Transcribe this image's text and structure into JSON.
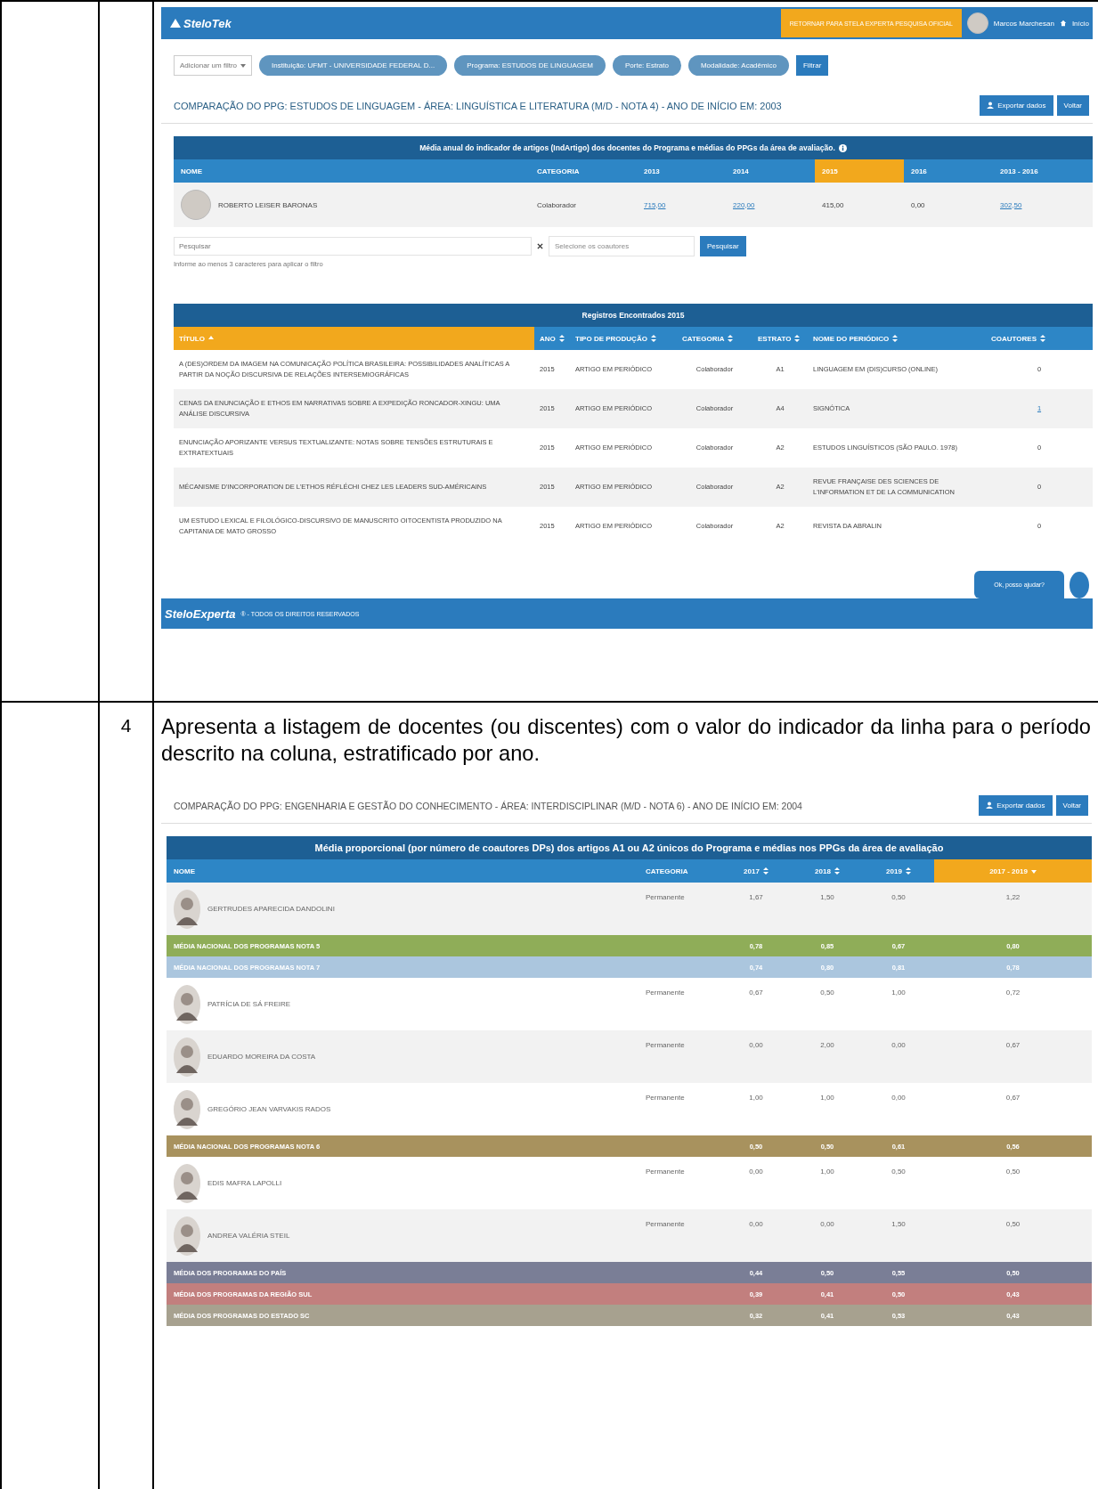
{
  "doc_rows": [
    {
      "number": "",
      "description": "",
      "screenshot": {
        "kind": "app"
      }
    },
    {
      "number": "4",
      "description": "Apresenta a listagem de docentes (ou discentes) com o valor do indicador da linha para o período descrito na coluna, estratificado por ano.",
      "screenshot": {
        "kind": "table"
      }
    }
  ],
  "app": {
    "logo": "SteloTek",
    "return_button": "RETORNAR PARA STELA EXPERTA PESQUISA OFICIAL",
    "user": "Marcos Marchesan",
    "nav_links": [
      "Início"
    ],
    "filter_dropdown": "Adicionar um filtro",
    "filter_chips": [
      "Instituição: UFMT - UNIVERSIDADE FEDERAL D...",
      "Programa: ESTUDOS DE LINGUAGEM",
      "Porte: Estrato",
      "Modalidade: Acadêmico"
    ],
    "filter_button": "Filtrar",
    "title": "COMPARAÇÃO DO PPG: ESTUDOS DE LINGUAGEM - ÁREA: LINGUÍSTICA E LITERATURA (M/D - NOTA 4) - ANO DE INÍCIO EM: 2003",
    "export_button": "Exportar dados",
    "back_button": "Voltar",
    "indicator_table": {
      "caption": "Média anual do indicador de artigos (IndArtigo) dos docentes do Programa e médias do PPGs da área de avaliação.",
      "columns": [
        {
          "label": "NOME",
          "selected": false
        },
        {
          "label": "CATEGORIA",
          "selected": false
        },
        {
          "label": "2013",
          "selected": false
        },
        {
          "label": "2014",
          "selected": false
        },
        {
          "label": "2015",
          "selected": true
        },
        {
          "label": "2016",
          "selected": false
        },
        {
          "label": "2013 - 2016",
          "selected": false
        }
      ],
      "rows": [
        {
          "name": "ROBERTO LEISER BARONAS",
          "category": "Colaborador",
          "values": [
            {
              "text": "715,00",
              "link": true
            },
            {
              "text": "220,00",
              "link": true
            },
            {
              "text": "415,00",
              "link": false
            },
            {
              "text": "0,00",
              "link": false
            },
            {
              "text": "302,50",
              "link": true
            }
          ]
        }
      ]
    },
    "search": {
      "placeholder": "Pesquisar",
      "hint": "Informe ao menos 3 caracteres para aplicar o filtro",
      "coauthor_select": "Selecione os coautores",
      "button": "Pesquisar"
    },
    "records_table": {
      "caption": "Registros Encontrados 2015",
      "columns": [
        {
          "label": "TÍTULO",
          "selected": true
        },
        {
          "label": "ANO",
          "selected": false
        },
        {
          "label": "TIPO DE PRODUÇÃO",
          "selected": false
        },
        {
          "label": "CATEGORIA",
          "selected": false
        },
        {
          "label": "ESTRATO",
          "selected": false
        },
        {
          "label": "NOME DO PERIÓDICO",
          "selected": false
        },
        {
          "label": "COAUTORES",
          "selected": false
        }
      ],
      "rows": [
        {
          "title": "A (DES)ORDEM DA IMAGEM NA COMUNICAÇÃO POLÍTICA BRASILEIRA: POSSIBILIDADES ANALÍTICAS A PARTIR DA NOÇÃO DISCURSIVA DE RELAÇÕES INTERSEMIOGRÁFICAS",
          "year": "2015",
          "type": "ARTIGO EM PERIÓDICO",
          "category": "Colaborador",
          "stratum": "A1",
          "journal": "LINGUAGEM EM (DIS)CURSO (ONLINE)",
          "coauthors": {
            "text": "0",
            "link": false
          }
        },
        {
          "title": "CENAS DA ENUNCIAÇÃO E ETHOS EM NARRATIVAS SOBRE A EXPEDIÇÃO RONCADOR-XINGU: UMA ANÁLISE DISCURSIVA",
          "year": "2015",
          "type": "ARTIGO EM PERIÓDICO",
          "category": "Colaborador",
          "stratum": "A4",
          "journal": "SIGNÓTICA",
          "coauthors": {
            "text": "1",
            "link": true
          }
        },
        {
          "title": "ENUNCIAÇÃO APORIZANTE VERSUS TEXTUALIZANTE: NOTAS SOBRE TENSÕES ESTRUTURAIS E EXTRATEXTUAIS",
          "year": "2015",
          "type": "ARTIGO EM PERIÓDICO",
          "category": "Colaborador",
          "stratum": "A2",
          "journal": "ESTUDOS LINGUÍSTICOS (SÃO PAULO. 1978)",
          "coauthors": {
            "text": "0",
            "link": false
          }
        },
        {
          "title": "MÉCANISME D'INCORPORATION DE L'ETHOS RÉFLÉCHI CHEZ LES LEADERS SUD-AMÉRICAINS",
          "year": "2015",
          "type": "ARTIGO EM PERIÓDICO",
          "category": "Colaborador",
          "stratum": "A2",
          "journal": "REVUE FRANÇAISE DES SCIENCES DE L'INFORMATION ET DE LA COMMUNICATION",
          "coauthors": {
            "text": "0",
            "link": false
          }
        },
        {
          "title": "UM ESTUDO LEXICAL E FILOLÓGICO-DISCURSIVO DE MANUSCRITO OITOCENTISTA PRODUZIDO NA CAPITANIA DE MATO GROSSO",
          "year": "2015",
          "type": "ARTIGO EM PERIÓDICO",
          "category": "Colaborador",
          "stratum": "A2",
          "journal": "REVISTA DA ABRALIN",
          "coauthors": {
            "text": "0",
            "link": false
          }
        }
      ]
    },
    "chat_button": "Ok, posso ajudar?",
    "footer_logo": "SteloExperta",
    "footer_text": "® - TODOS OS DIREITOS RESERVADOS"
  },
  "comparison": {
    "title": "COMPARAÇÃO DO PPG: ENGENHARIA E GESTÃO DO CONHECIMENTO - ÁREA: INTERDISCIPLINAR (M/D - NOTA 6) - ANO DE INÍCIO EM: 2004",
    "export_button": "Exportar dados",
    "back_button": "Voltar",
    "caption": "Média proporcional (por número de coautores DPs) dos artigos A1 ou A2 únicos do Programa e médias nos PPGs da área de avaliação",
    "columns": [
      {
        "label": "NOME",
        "sortable": false,
        "selected": false
      },
      {
        "label": "CATEGORIA",
        "sortable": false,
        "selected": false
      },
      {
        "label": "2017",
        "sortable": true,
        "selected": false
      },
      {
        "label": "2018",
        "sortable": true,
        "selected": false
      },
      {
        "label": "2019",
        "sortable": true,
        "selected": false
      },
      {
        "label": "2017 - 2019",
        "sortable": true,
        "selected": true
      }
    ],
    "rows": [
      {
        "kind": "person",
        "name": "GERTRUDES APARECIDA DANDOLINI",
        "category": "Permanente",
        "values": [
          "1,67",
          "1,50",
          "0,50",
          "1,22"
        ]
      },
      {
        "kind": "average",
        "name": "MÉDIA NACIONAL DOS PROGRAMAS NOTA 5",
        "color": "#8fad58",
        "values": [
          "0,78",
          "0,85",
          "0,67",
          "0,80"
        ]
      },
      {
        "kind": "average",
        "name": "MÉDIA NACIONAL DOS PROGRAMAS NOTA 7",
        "color": "#abc6de",
        "values": [
          "0,74",
          "0,80",
          "0,81",
          "0,78"
        ]
      },
      {
        "kind": "person",
        "name": "PATRÍCIA DE SÁ FREIRE",
        "category": "Permanente",
        "values": [
          "0,67",
          "0,50",
          "1,00",
          "0,72"
        ]
      },
      {
        "kind": "person",
        "name": "EDUARDO MOREIRA DA COSTA",
        "category": "Permanente",
        "values": [
          "0,00",
          "2,00",
          "0,00",
          "0,67"
        ]
      },
      {
        "kind": "person",
        "name": "GREGÓRIO JEAN VARVAKIS RADOS",
        "category": "Permanente",
        "values": [
          "1,00",
          "1,00",
          "0,00",
          "0,67"
        ]
      },
      {
        "kind": "average",
        "name": "MÉDIA NACIONAL DOS PROGRAMAS NOTA 6",
        "color": "#a8925e",
        "values": [
          "0,50",
          "0,50",
          "0,61",
          "0,56"
        ]
      },
      {
        "kind": "person",
        "name": "EDIS MAFRA LAPOLLI",
        "category": "Permanente",
        "values": [
          "0,00",
          "1,00",
          "0,50",
          "0,50"
        ]
      },
      {
        "kind": "person",
        "name": "ANDREA VALÉRIA STEIL",
        "category": "Permanente",
        "values": [
          "0,00",
          "0,00",
          "1,50",
          "0,50"
        ]
      },
      {
        "kind": "average",
        "name": "MÉDIA DOS PROGRAMAS DO PAÍS",
        "color": "#7a7e96",
        "values": [
          "0,44",
          "0,50",
          "0,55",
          "0,50"
        ]
      },
      {
        "kind": "average",
        "name": "MÉDIA DOS PROGRAMAS DA REGIÃO SUL",
        "color": "#c27f7e",
        "values": [
          "0,39",
          "0,41",
          "0,50",
          "0,43"
        ]
      },
      {
        "kind": "average",
        "name": "MÉDIA DOS PROGRAMAS DO ESTADO SC",
        "color": "#a7a18f",
        "values": [
          "0,32",
          "0,41",
          "0,53",
          "0,43"
        ]
      }
    ]
  }
}
